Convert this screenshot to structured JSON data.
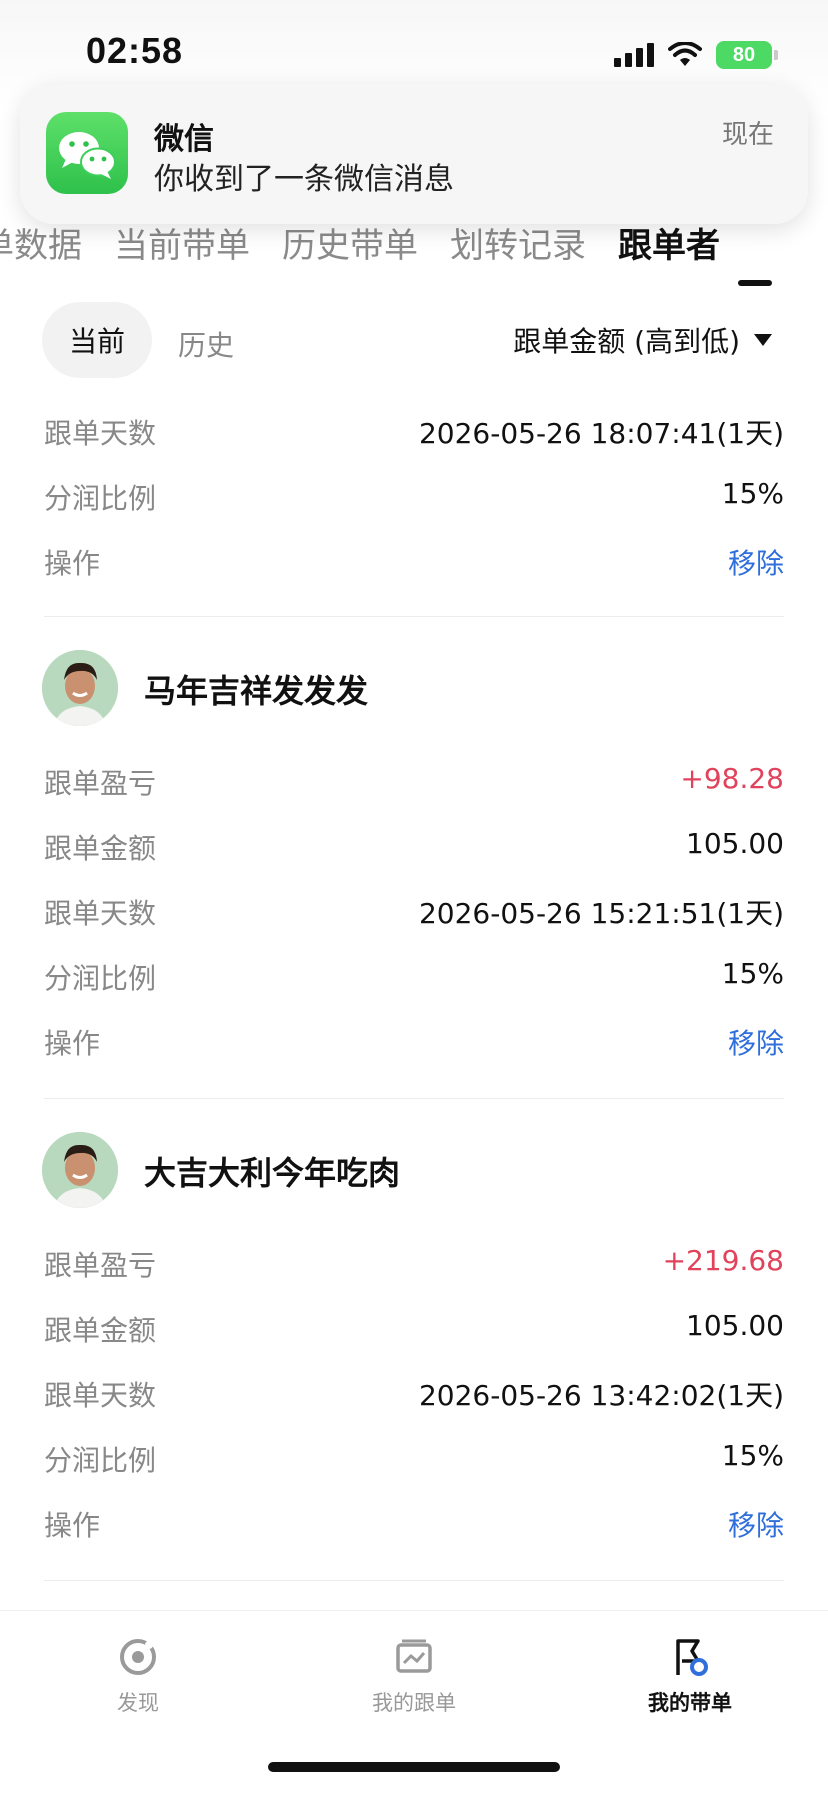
{
  "status_bar": {
    "time": "02:58",
    "battery": "80"
  },
  "notification": {
    "app": "微信",
    "message": "你收到了一条微信消息",
    "time": "现在"
  },
  "tabs": [
    "单数据",
    "当前带单",
    "历史带单",
    "划转记录",
    "跟单者"
  ],
  "filter": {
    "current": "当前",
    "history": "历史",
    "sort": "跟单金额 (高到低)"
  },
  "first_entry": {
    "rows": [
      {
        "label": "跟单天数",
        "value": "2026-05-26 18:07:41(1天)"
      },
      {
        "label": "分润比例",
        "value": "15%"
      },
      {
        "label": "操作",
        "value": "移除"
      }
    ]
  },
  "followers": [
    {
      "name": "马年吉祥发发发",
      "profit_label": "跟单盈亏",
      "profit": "+98.28",
      "amount_label": "跟单金额",
      "amount": "105.00",
      "days_label": "跟单天数",
      "days": "2026-05-26 15:21:51(1天)",
      "share_label": "分润比例",
      "share": "15%",
      "action_label": "操作",
      "action": "移除"
    },
    {
      "name": "大吉大利今年吃肉",
      "profit_label": "跟单盈亏",
      "profit": "+219.68",
      "amount_label": "跟单金额",
      "amount": "105.00",
      "days_label": "跟单天数",
      "days": "2026-05-26 13:42:02(1天)",
      "share_label": "分润比例",
      "share": "15%",
      "action_label": "操作",
      "action": "移除"
    }
  ],
  "bottom_nav": [
    {
      "label": "发现",
      "icon": "discover-icon"
    },
    {
      "label": "我的跟单",
      "icon": "chart-card-icon"
    },
    {
      "label": "我的带单",
      "icon": "flag-icon"
    }
  ],
  "colors": {
    "profit": "#e0435b",
    "action": "#2f6fdc",
    "wechat": "#2ec14b"
  }
}
